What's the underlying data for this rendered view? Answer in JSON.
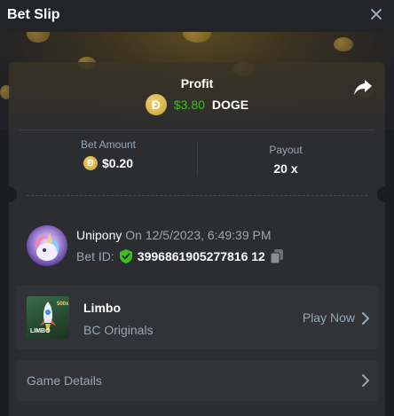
{
  "header": {
    "title": "Bet Slip"
  },
  "profit": {
    "label": "Profit",
    "amount": "$3.80",
    "currency": "DOGE",
    "coin_symbol": "Ð"
  },
  "stats": {
    "bet_amount_label": "Bet Amount",
    "bet_amount_value": "$0.20",
    "payout_label": "Payout",
    "payout_value": "20 x"
  },
  "bet": {
    "username": "Unipony",
    "date_text": "On 12/5/2023, 6:49:39 PM",
    "bet_id_label": "Bet ID:",
    "bet_id_value": "3996861905277816 12"
  },
  "game": {
    "name": "Limbo",
    "provider": "BC Originals",
    "play_now_label": "Play Now",
    "thumb_text": "LIMBO"
  },
  "details": {
    "label": "Game Details"
  },
  "colors": {
    "profit_green": "#3bc117",
    "muted_text": "#98a7b5",
    "doge_gold": "#c9a13b",
    "shield_green": "#3bc117"
  }
}
